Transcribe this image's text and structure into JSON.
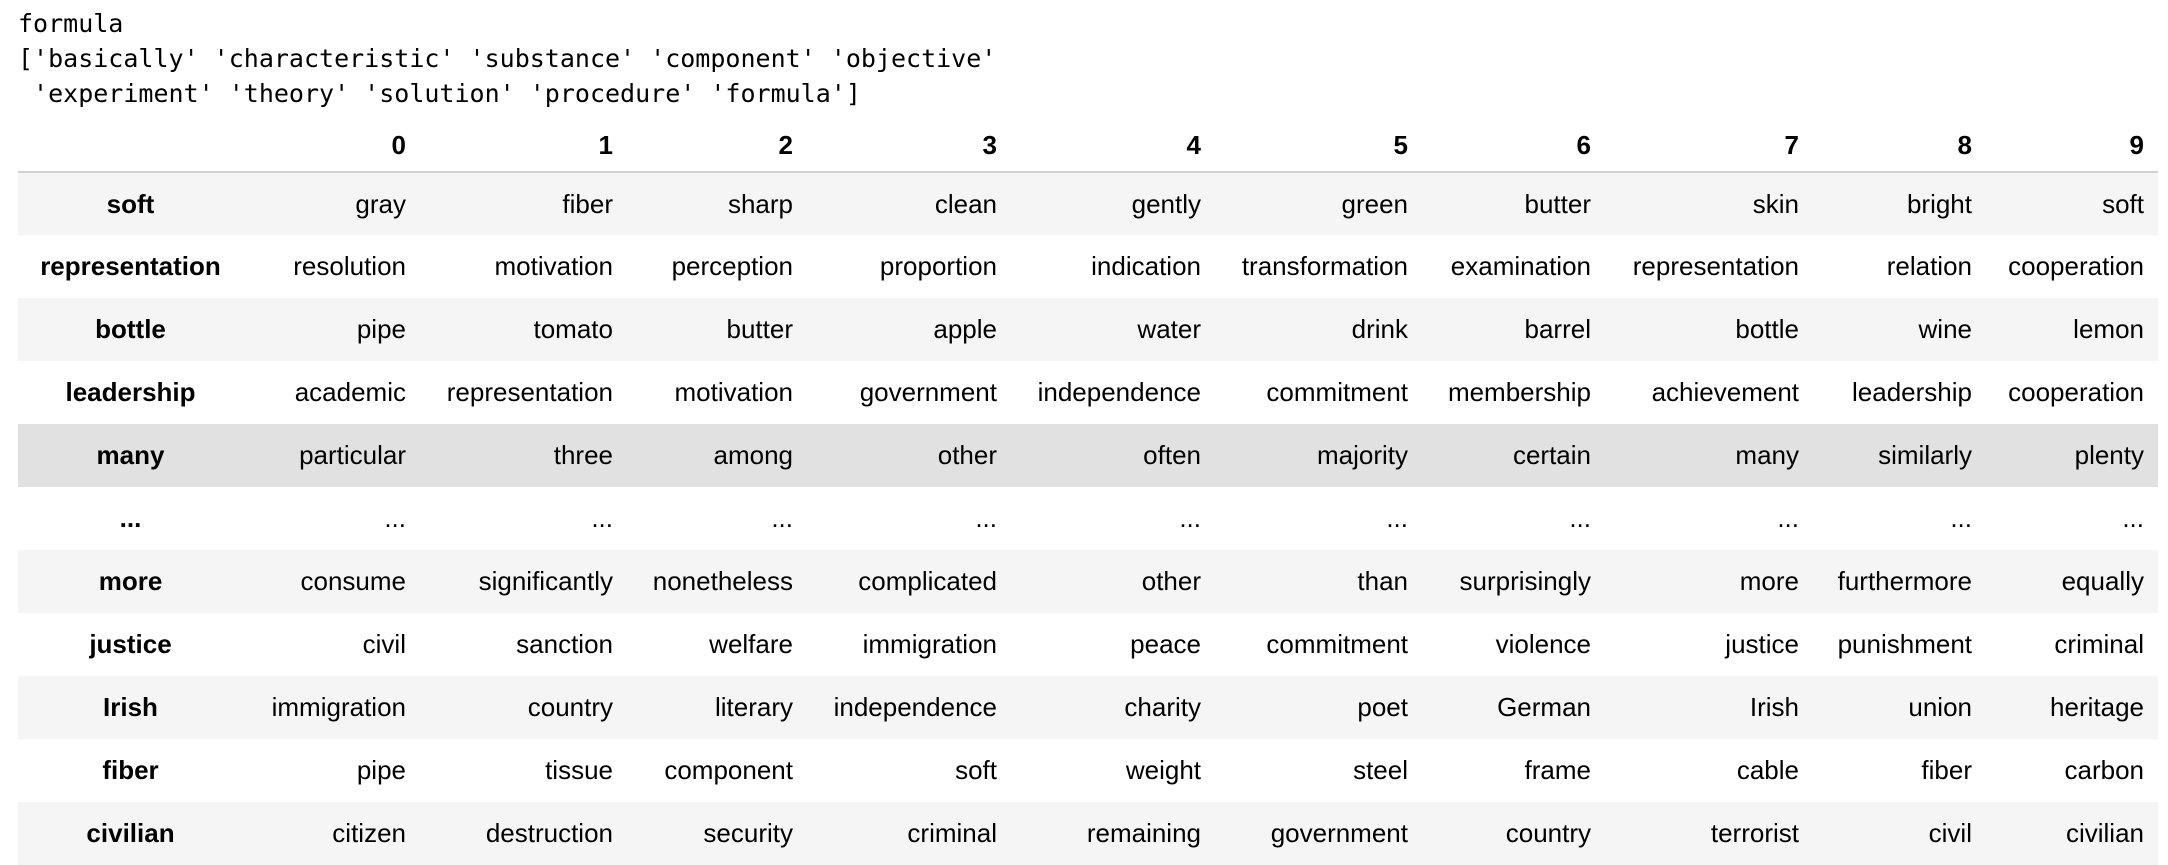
{
  "output": {
    "line1": "formula",
    "line2": "['basically' 'characteristic' 'substance' 'component' 'objective'",
    "line3": " 'experiment' 'theory' 'solution' 'procedure' 'formula']"
  },
  "table": {
    "corner": "",
    "columns": [
      "0",
      "1",
      "2",
      "3",
      "4",
      "5",
      "6",
      "7",
      "8",
      "9"
    ],
    "rows": [
      {
        "index": "soft",
        "cells": [
          "gray",
          "fiber",
          "sharp",
          "clean",
          "gently",
          "green",
          "butter",
          "skin",
          "bright",
          "soft"
        ]
      },
      {
        "index": "representation",
        "cells": [
          "resolution",
          "motivation",
          "perception",
          "proportion",
          "indication",
          "transformation",
          "examination",
          "representation",
          "relation",
          "cooperation"
        ]
      },
      {
        "index": "bottle",
        "cells": [
          "pipe",
          "tomato",
          "butter",
          "apple",
          "water",
          "drink",
          "barrel",
          "bottle",
          "wine",
          "lemon"
        ]
      },
      {
        "index": "leadership",
        "cells": [
          "academic",
          "representation",
          "motivation",
          "government",
          "independence",
          "commitment",
          "membership",
          "achievement",
          "leadership",
          "cooperation"
        ]
      },
      {
        "index": "many",
        "cells": [
          "particular",
          "three",
          "among",
          "other",
          "often",
          "majority",
          "certain",
          "many",
          "similarly",
          "plenty"
        ]
      },
      {
        "index": "...",
        "cells": [
          "...",
          "...",
          "...",
          "...",
          "...",
          "...",
          "...",
          "...",
          "...",
          "..."
        ]
      },
      {
        "index": "more",
        "cells": [
          "consume",
          "significantly",
          "nonetheless",
          "complicated",
          "other",
          "than",
          "surprisingly",
          "more",
          "furthermore",
          "equally"
        ]
      },
      {
        "index": "justice",
        "cells": [
          "civil",
          "sanction",
          "welfare",
          "immigration",
          "peace",
          "commitment",
          "violence",
          "justice",
          "punishment",
          "criminal"
        ]
      },
      {
        "index": "Irish",
        "cells": [
          "immigration",
          "country",
          "literary",
          "independence",
          "charity",
          "poet",
          "German",
          "Irish",
          "union",
          "heritage"
        ]
      },
      {
        "index": "fiber",
        "cells": [
          "pipe",
          "tissue",
          "component",
          "soft",
          "weight",
          "steel",
          "frame",
          "cable",
          "fiber",
          "carbon"
        ]
      },
      {
        "index": "civilian",
        "cells": [
          "citizen",
          "destruction",
          "security",
          "criminal",
          "remaining",
          "government",
          "country",
          "terrorist",
          "civil",
          "civilian"
        ]
      }
    ]
  }
}
